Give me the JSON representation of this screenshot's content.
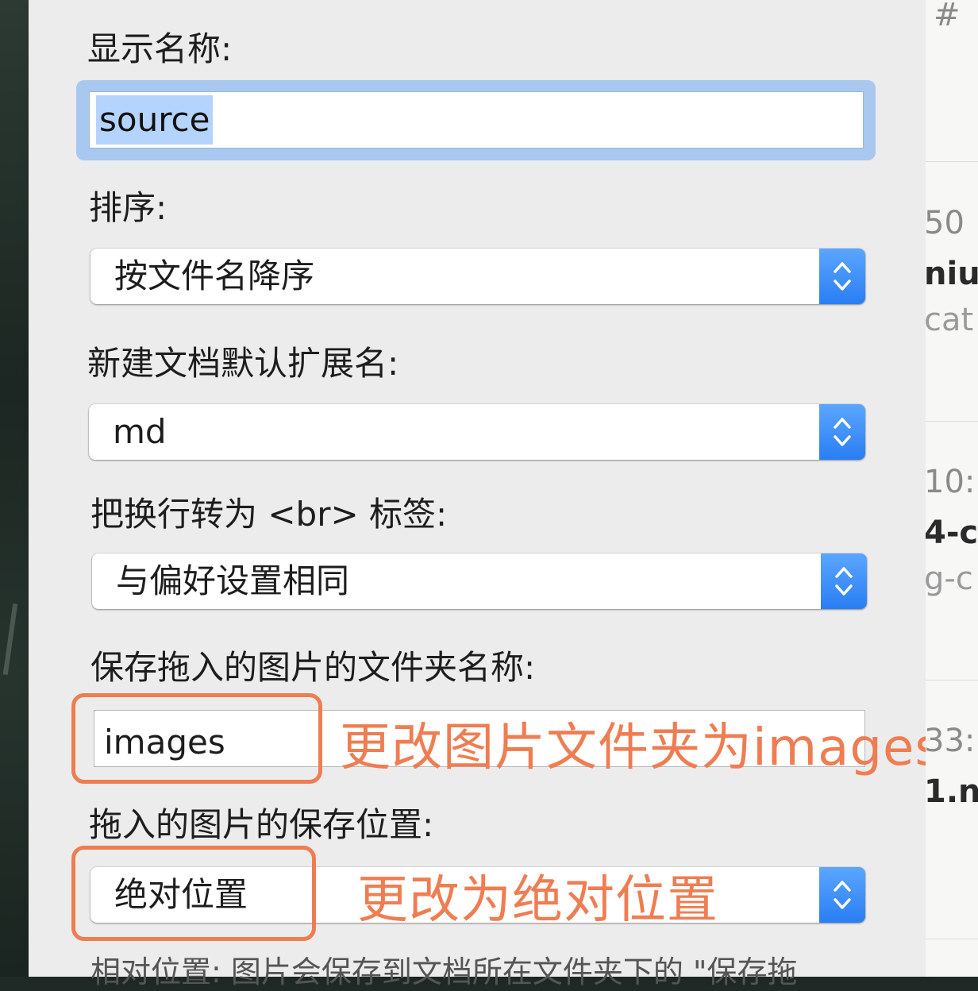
{
  "fields": {
    "display_name": {
      "label": "显示名称:",
      "value": "source"
    },
    "sort": {
      "label": "排序:",
      "value": "按文件名降序"
    },
    "default_ext": {
      "label": "新建文档默认扩展名:",
      "value": "md"
    },
    "line_break": {
      "label": "把换行转为 <br> 标签:",
      "value": "与偏好设置相同"
    },
    "image_folder": {
      "label": "保存拖入的图片的文件夹名称:",
      "value": "images"
    },
    "image_location": {
      "label": "拖入的图片的保存位置:",
      "value": "绝对位置"
    }
  },
  "annotations": {
    "image_folder_note": "更改图片文件夹为images",
    "image_location_note": "更改为绝对位置"
  },
  "footer_note": "相对位置: 图片会保存到文档所在文件夹下的 \"保存拖",
  "background_window": {
    "hash": "#",
    "row1_num": "50",
    "row1_bold": "niu",
    "row1_light": "cat",
    "row2_num": "10:",
    "row2_bold": "4-c",
    "row2_light": "g-c",
    "row3_num": "33:",
    "row3_bold": "1.n"
  },
  "colors": {
    "accent_blue": "#2a7ef3",
    "annotation_orange": "#ef7d52",
    "focus_ring": "#a8c8ef"
  }
}
